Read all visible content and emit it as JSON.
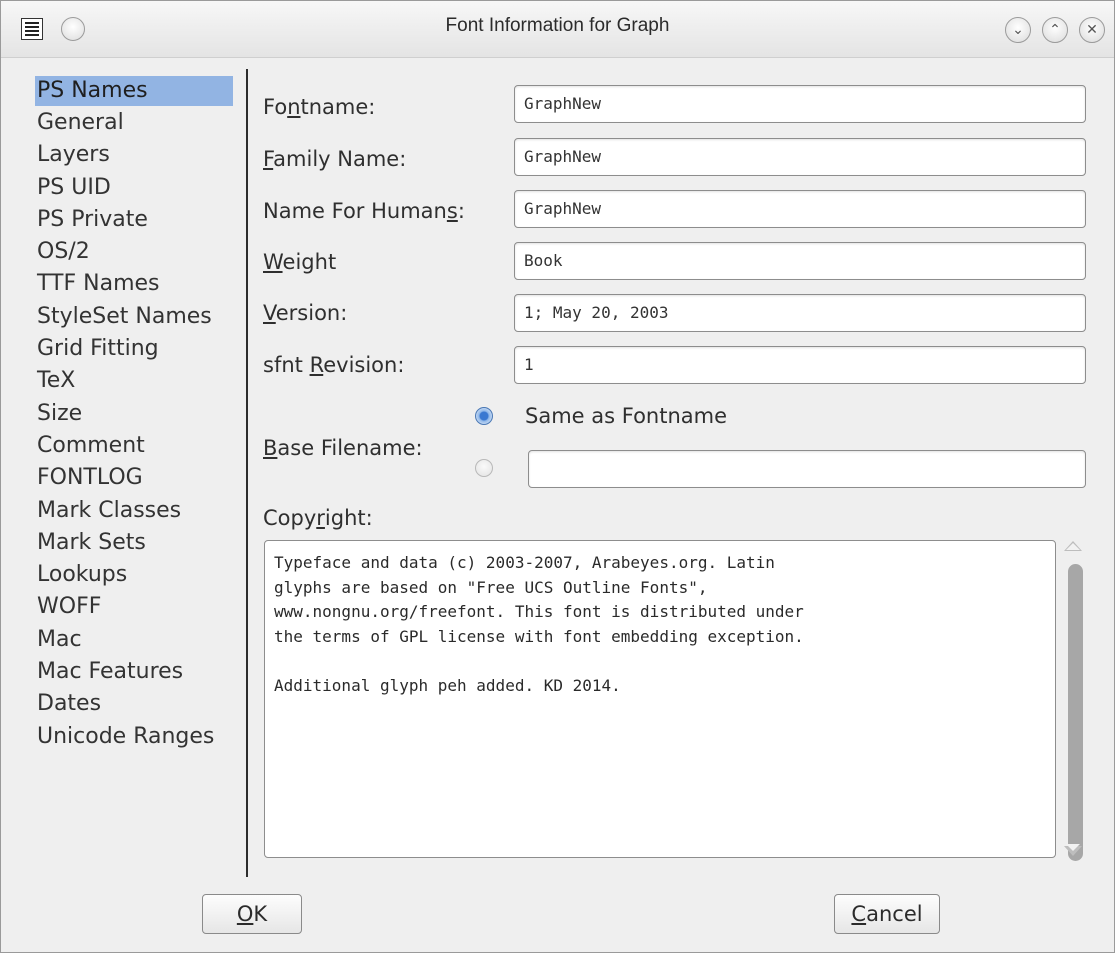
{
  "window": {
    "title": "Font Information for Graph",
    "controls": {
      "minimize": "⌄",
      "maximize": "⌃",
      "close": "✕"
    }
  },
  "sidebar": {
    "selected": "PS Names",
    "items": [
      "PS Names",
      "General",
      "Layers",
      "PS UID",
      "PS Private",
      "OS/2",
      "TTF Names",
      "StyleSet Names",
      "Grid Fitting",
      "TeX",
      "Size",
      "Comment",
      "FONTLOG",
      "Mark Classes",
      "Mark Sets",
      "Lookups",
      "WOFF",
      "Mac",
      "Mac Features",
      "Dates",
      "Unicode Ranges"
    ]
  },
  "form": {
    "fontname": {
      "label_pre": "Fo",
      "label_key": "n",
      "label_post": "tname:",
      "value": "GraphNew"
    },
    "family_name": {
      "label_pre": "",
      "label_key": "F",
      "label_post": "amily Name:",
      "value": "GraphNew"
    },
    "name_for_humans": {
      "label_pre": "Name For Human",
      "label_key": "s",
      "label_post": ":",
      "value": "GraphNew"
    },
    "weight": {
      "label_pre": "",
      "label_key": "W",
      "label_post": "eight",
      "value": "Book"
    },
    "version": {
      "label_pre": "",
      "label_key": "V",
      "label_post": "ersion:",
      "value": "1; May 20, 2003"
    },
    "sfnt_revision": {
      "label_pre": "sfnt ",
      "label_key": "R",
      "label_post": "evision:",
      "value": "1"
    },
    "base_filename": {
      "label_pre": "",
      "label_key": "B",
      "label_post": "ase Filename:",
      "option_same": "Same as Fontname",
      "selected": "same",
      "custom_value": ""
    },
    "copyright": {
      "label_pre": "Copy",
      "label_key": "r",
      "label_post": "ight:",
      "text": "Typeface and data (c) 2003-2007, Arabeyes.org. Latin\nglyphs are based on \"Free UCS Outline Fonts\",\nwww.nongnu.org/freefont. This font is distributed under\nthe terms of GPL license with font embedding exception.\n\nAdditional glyph peh added. KD 2014."
    }
  },
  "buttons": {
    "ok": {
      "key": "O",
      "rest": "K"
    },
    "cancel": {
      "key": "C",
      "rest": "ancel"
    }
  }
}
